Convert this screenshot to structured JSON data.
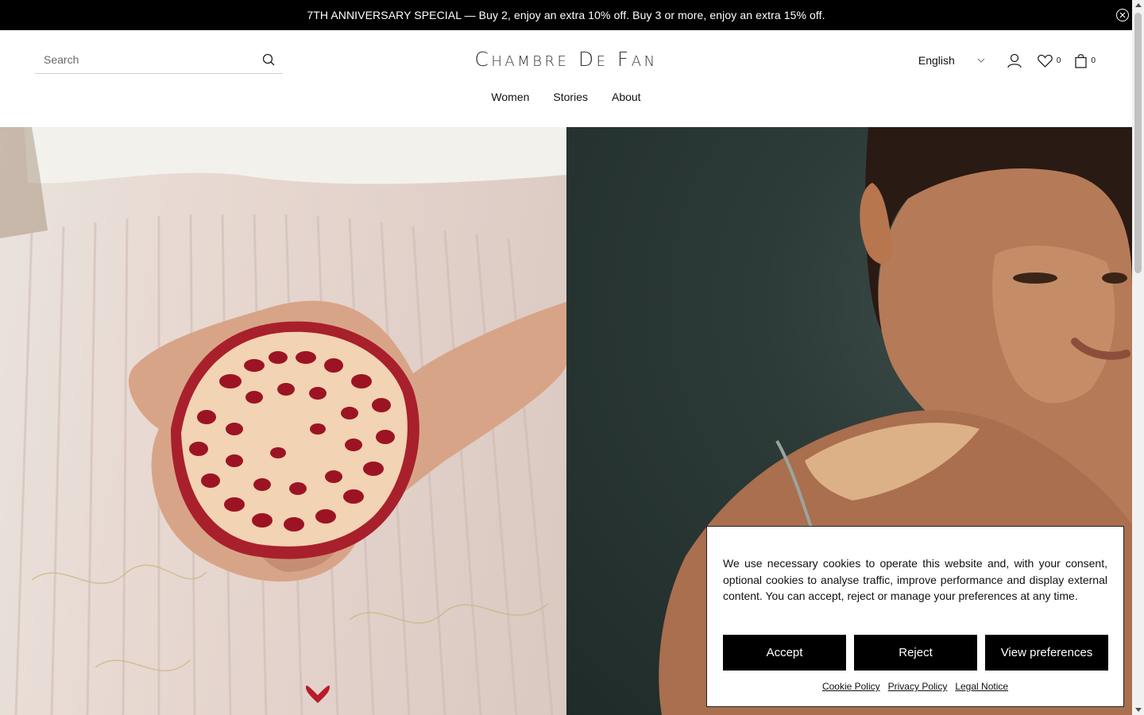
{
  "announcement": {
    "text": "7TH ANNIVERSARY SPECIAL — Buy 2, enjoy an extra 10% off. Buy 3 or more, enjoy an extra 15% off."
  },
  "header": {
    "search_placeholder": "Search",
    "logo": "Chambre De Fan",
    "language": "English",
    "wishlist_count": "0",
    "cart_count": "0"
  },
  "nav": {
    "items": [
      {
        "label": "Women"
      },
      {
        "label": "Stories"
      },
      {
        "label": "About"
      }
    ]
  },
  "cookie_banner": {
    "text": "We use necessary cookies to operate this website and, with your consent, optional cookies to analyse traffic, improve performance and display external content. You can accept, reject or manage your preferences at any time.",
    "accept_label": "Accept",
    "reject_label": "Reject",
    "preferences_label": "View preferences",
    "links": [
      {
        "label": "Cookie Policy"
      },
      {
        "label": "Privacy Policy"
      },
      {
        "label": "Legal Notice"
      }
    ]
  }
}
